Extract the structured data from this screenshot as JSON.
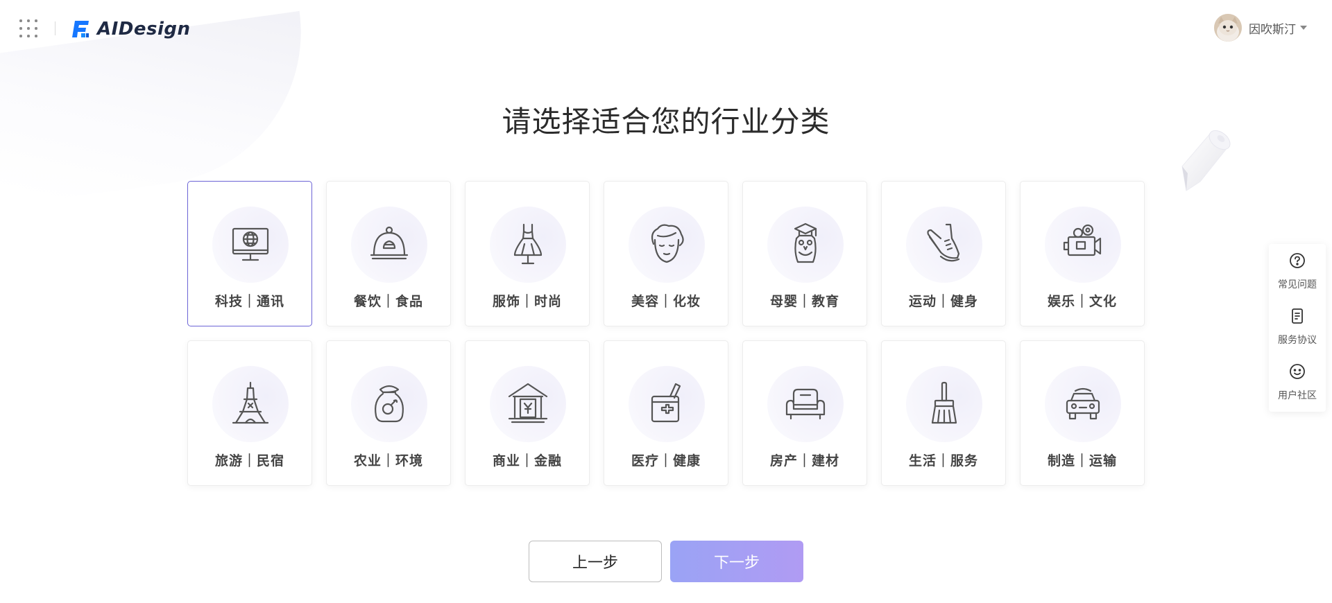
{
  "app": {
    "brand": "AIDesign",
    "user_name": "因吹斯汀"
  },
  "page": {
    "title": "请选择适合您的行业分类"
  },
  "categories": [
    {
      "label": "科技｜通讯",
      "icon": "monitor-globe-icon",
      "selected": true
    },
    {
      "label": "餐饮｜食品",
      "icon": "food-cloche-icon",
      "selected": false
    },
    {
      "label": "服饰｜时尚",
      "icon": "dress-icon",
      "selected": false
    },
    {
      "label": "美容｜化妆",
      "icon": "face-icon",
      "selected": false
    },
    {
      "label": "母婴｜教育",
      "icon": "owl-graduate-icon",
      "selected": false
    },
    {
      "label": "运动｜健身",
      "icon": "sneaker-icon",
      "selected": false
    },
    {
      "label": "娱乐｜文化",
      "icon": "video-camera-icon",
      "selected": false
    },
    {
      "label": "旅游｜民宿",
      "icon": "eiffel-tower-icon",
      "selected": false
    },
    {
      "label": "农业｜环境",
      "icon": "grain-sack-icon",
      "selected": false
    },
    {
      "label": "商业｜金融",
      "icon": "bank-yuan-icon",
      "selected": false
    },
    {
      "label": "医疗｜健康",
      "icon": "medical-kit-icon",
      "selected": false
    },
    {
      "label": "房产｜建材",
      "icon": "sofa-icon",
      "selected": false
    },
    {
      "label": "生活｜服务",
      "icon": "broom-icon",
      "selected": false
    },
    {
      "label": "制造｜运输",
      "icon": "car-icon",
      "selected": false
    }
  ],
  "buttons": {
    "prev": "上一步",
    "next": "下一步"
  },
  "side_panel": [
    {
      "label": "常见问题",
      "icon": "question-circle-icon"
    },
    {
      "label": "服务协议",
      "icon": "document-icon"
    },
    {
      "label": "用户社区",
      "icon": "smile-icon"
    }
  ],
  "colors": {
    "accent": "#6b63d6",
    "next_button_start": "#9aa3f5",
    "next_button_end": "#b09bf3",
    "logo_blue": "#1677ff"
  }
}
